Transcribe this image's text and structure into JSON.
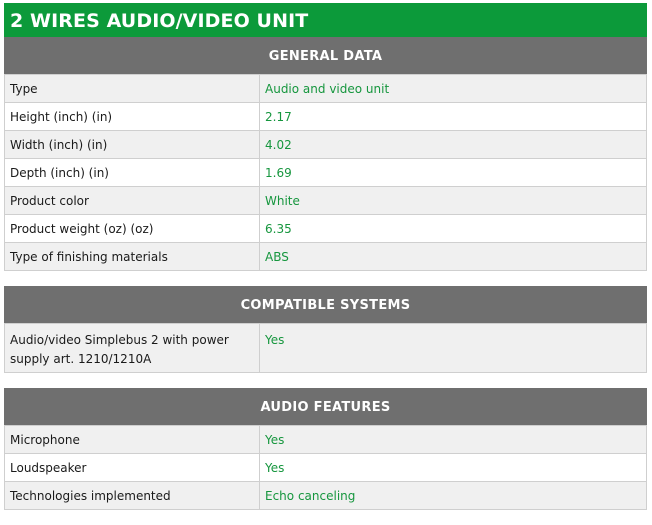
{
  "title": "2 WIRES AUDIO/VIDEO UNIT",
  "sections": [
    {
      "header": "GENERAL DATA",
      "rows": [
        {
          "label": "Type",
          "value": "Audio and video unit"
        },
        {
          "label": "Height (inch) (in)",
          "value": "2.17"
        },
        {
          "label": "Width (inch) (in)",
          "value": "4.02"
        },
        {
          "label": "Depth (inch) (in)",
          "value": "1.69"
        },
        {
          "label": "Product color",
          "value": "White"
        },
        {
          "label": "Product weight (oz) (oz)",
          "value": "6.35"
        },
        {
          "label": "Type of finishing materials",
          "value": "ABS"
        }
      ]
    },
    {
      "header": "COMPATIBLE SYSTEMS",
      "rows": [
        {
          "label": "Audio/video Simplebus 2 with power supply art. 1210/1210A",
          "value": "Yes"
        }
      ]
    },
    {
      "header": "AUDIO FEATURES",
      "rows": [
        {
          "label": "Microphone",
          "value": "Yes"
        },
        {
          "label": "Loudspeaker",
          "value": "Yes"
        },
        {
          "label": "Technologies implemented",
          "value": "Echo canceling"
        }
      ]
    }
  ],
  "colors": {
    "title_bg": "#0c9a3a",
    "header_bg": "#6f6f6f",
    "value_text": "#16963e",
    "alt_row_bg": "#f0f0f0"
  }
}
